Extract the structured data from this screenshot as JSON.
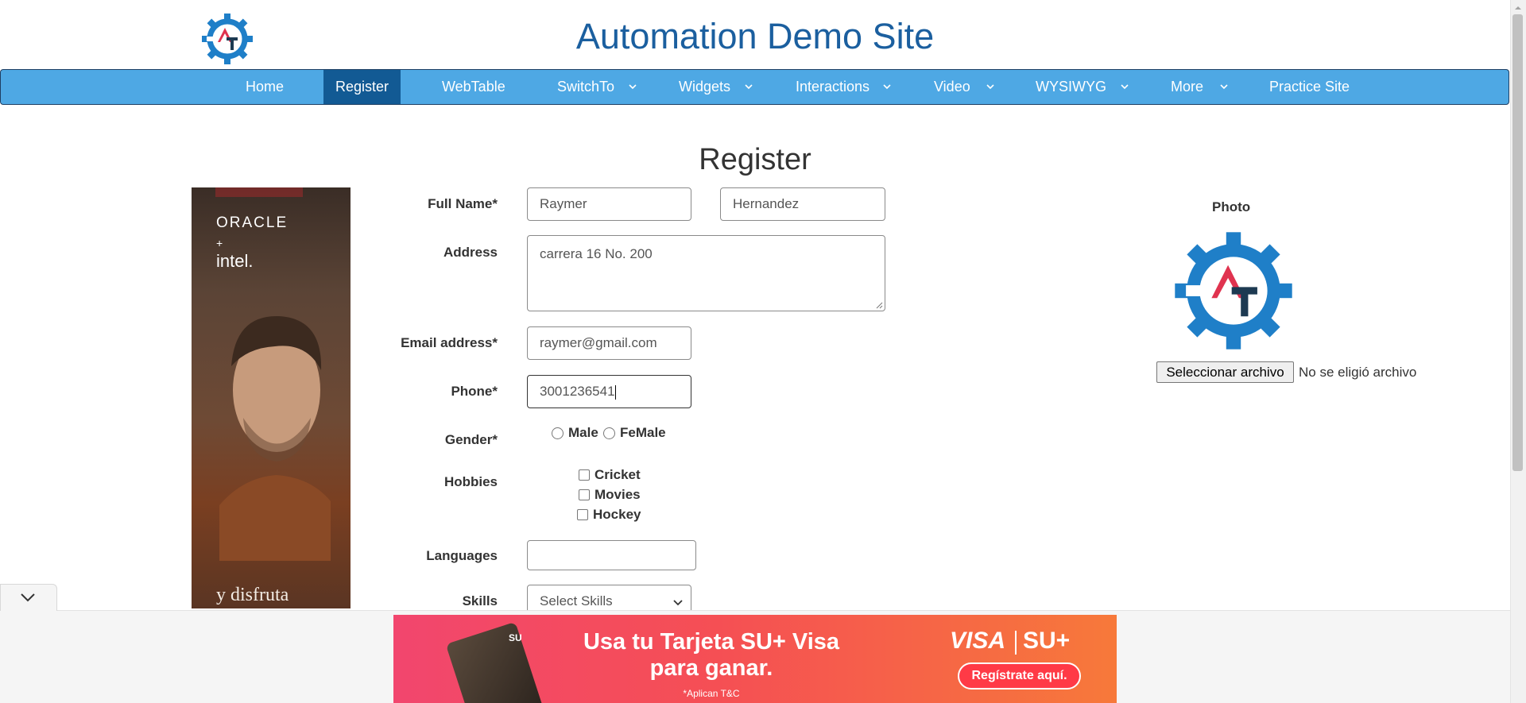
{
  "header": {
    "title": "Automation Demo Site",
    "logo_icon": "automation-gear-logo-icon"
  },
  "nav": {
    "items": [
      {
        "label": "Home",
        "dropdown": false
      },
      {
        "label": "Register",
        "dropdown": false,
        "active": true
      },
      {
        "label": "WebTable",
        "dropdown": false
      },
      {
        "label": "SwitchTo",
        "dropdown": true
      },
      {
        "label": "Widgets",
        "dropdown": true
      },
      {
        "label": "Interactions",
        "dropdown": true
      },
      {
        "label": "Video",
        "dropdown": true
      },
      {
        "label": "WYSIWYG",
        "dropdown": true
      },
      {
        "label": "More",
        "dropdown": true
      },
      {
        "label": "Practice Site",
        "dropdown": false
      }
    ],
    "colors": {
      "bar": "#4ea8e4",
      "active": "#125a94"
    }
  },
  "page": {
    "heading": "Register"
  },
  "form": {
    "full_name_label": "Full Name*",
    "first_name_value": "Raymer",
    "last_name_value": "Hernandez",
    "address_label": "Address",
    "address_value": "carrera 16 No. 200",
    "email_label": "Email address*",
    "email_value": "raymer@gmail.com",
    "phone_label": "Phone*",
    "phone_value": "3001236541",
    "gender_label": "Gender*",
    "gender_options": [
      "Male",
      "FeMale"
    ],
    "hobbies_label": "Hobbies",
    "hobby_options": [
      "Cricket",
      "Movies",
      "Hockey"
    ],
    "languages_label": "Languages",
    "languages_value": "",
    "skills_label": "Skills",
    "skills_selected": "Select Skills"
  },
  "photo": {
    "label": "Photo",
    "button_label": "Seleccionar archivo",
    "file_status": "No se eligió archivo"
  },
  "left_ad": {
    "line1": "ORACLE",
    "line2": "+",
    "line3": "intel.",
    "tagline": "y disfruta"
  },
  "bottom_ad": {
    "headline_1": "Usa tu Tarjeta SU+ Visa",
    "headline_2": "para ganar.",
    "footnote": "*Aplican T&C",
    "brand_visa": "VISA",
    "brand_su": "SU+",
    "cta": "Regístrate aquí.",
    "card_brand": "SU"
  }
}
